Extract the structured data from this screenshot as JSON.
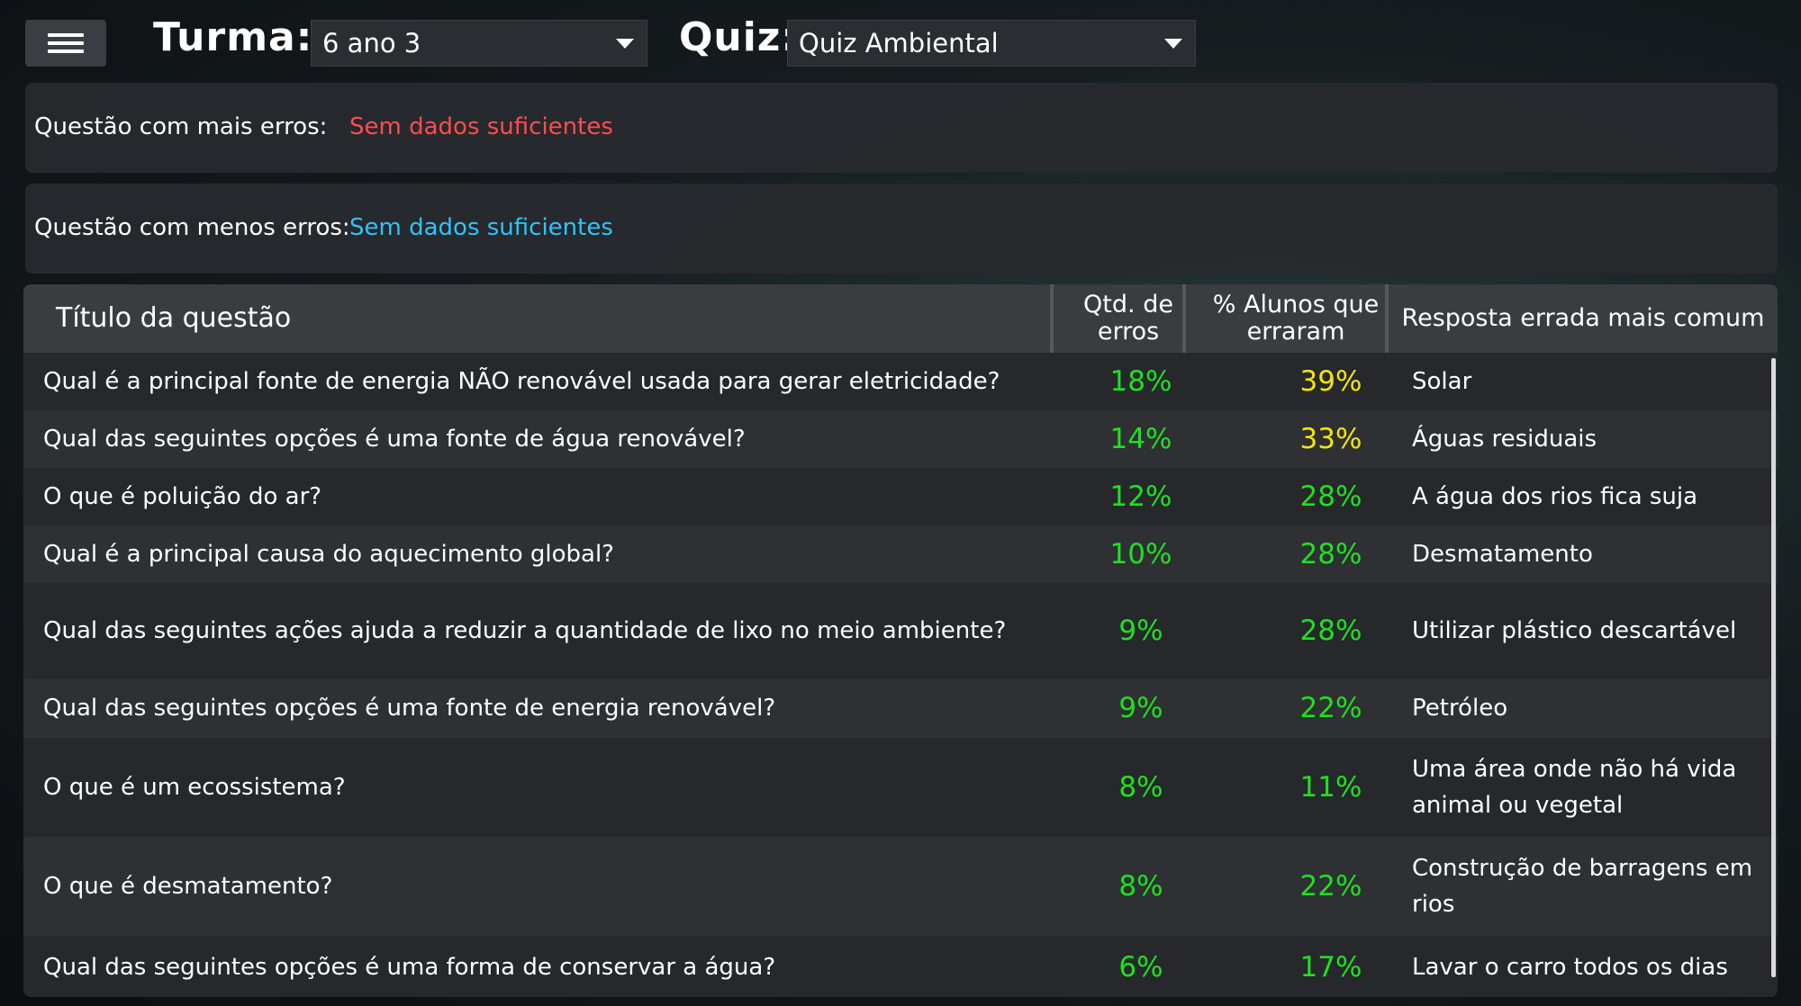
{
  "header": {
    "turma_label": "Turma:",
    "turma_value": "6 ano 3",
    "quiz_label": "Quiz:",
    "quiz_value": "Quiz Ambiental"
  },
  "summary": {
    "most_errors_label": "Questão com mais erros:",
    "most_errors_value": "Sem dados suficientes",
    "least_errors_label": "Questão com menos erros:",
    "least_errors_value": "Sem dados suficientes"
  },
  "colors": {
    "most_errors": "#ff4d4d",
    "least_errors": "#2ec4ff",
    "green": "#20e020",
    "yellow": "#f2e60c"
  },
  "table": {
    "headers": [
      "Título da questão",
      "Qtd. de erros",
      "% Alunos que erraram",
      "Resposta errada mais comum"
    ],
    "rows": [
      {
        "title": "Qual é a principal fonte de energia NÃO renovável usada para gerar eletricidade?",
        "errors": "18%",
        "pct": "39%",
        "answer": "Solar",
        "pct_color": "yellow"
      },
      {
        "title": "Qual das seguintes opções é uma fonte de água renovável?",
        "errors": "14%",
        "pct": "33%",
        "answer": "Águas residuais",
        "pct_color": "yellow"
      },
      {
        "title": "O que é poluição do ar?",
        "errors": "12%",
        "pct": "28%",
        "answer": "A água dos rios fica suja",
        "pct_color": "green"
      },
      {
        "title": "Qual é a principal causa do aquecimento global?",
        "errors": "10%",
        "pct": "28%",
        "answer": "Desmatamento",
        "pct_color": "green"
      },
      {
        "title": "Qual das seguintes ações ajuda a reduzir a quantidade de lixo no meio ambiente?",
        "errors": "9%",
        "pct": "28%",
        "answer": "Utilizar plástico descartável",
        "pct_color": "green"
      },
      {
        "title": "Qual das seguintes opções é uma fonte de energia renovável?",
        "errors": "9%",
        "pct": "22%",
        "answer": "Petróleo",
        "pct_color": "green"
      },
      {
        "title": "O que é um ecossistema?",
        "errors": "8%",
        "pct": "11%",
        "answer": "Uma área onde não há vida animal ou vegetal",
        "pct_color": "green"
      },
      {
        "title": "O que é desmatamento?",
        "errors": "8%",
        "pct": "22%",
        "answer": "Construção de barragens em rios",
        "pct_color": "green"
      },
      {
        "title": "Qual das seguintes opções é uma forma de conservar a água?",
        "errors": "6%",
        "pct": "17%",
        "answer": "Lavar o carro todos os dias",
        "pct_color": "green"
      }
    ]
  }
}
